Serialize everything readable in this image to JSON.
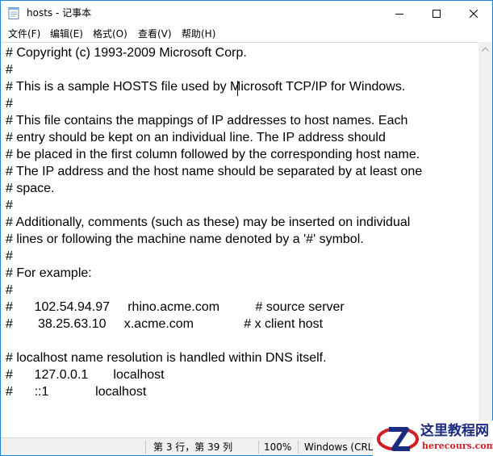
{
  "window": {
    "title": "hosts - 记事本"
  },
  "menu": [
    "文件(F)",
    "编辑(E)",
    "格式(O)",
    "查看(V)",
    "帮助(H)"
  ],
  "document": {
    "lines": [
      "# Copyright (c) 1993-2009 Microsoft Corp.",
      "#",
      "# This is a sample HOSTS file used by Microsoft TCP/IP for Windows.",
      "#",
      "# This file contains the mappings of IP addresses to host names. Each",
      "# entry should be kept on an individual line. The IP address should",
      "# be placed in the first column followed by the corresponding host name.",
      "# The IP address and the host name should be separated by at least one",
      "# space.",
      "#",
      "# Additionally, comments (such as these) may be inserted on individual",
      "# lines or following the machine name denoted by a '#' symbol.",
      "#",
      "# For example:",
      "#",
      "#      102.54.94.97     rhino.acme.com          # source server",
      "#       38.25.63.10     x.acme.com              # x client host",
      "",
      "# localhost name resolution is handled within DNS itself.",
      "#\t127.0.0.1       localhost",
      "#\t::1             localhost"
    ]
  },
  "status": {
    "position": "第 3 行，第 39 列",
    "zoom": "100%",
    "line_ending": "Windows (CRLF)"
  },
  "watermark": {
    "name": "这里教程网",
    "site": "herecours.com"
  },
  "colors": {
    "window_border": "#1883d7",
    "watermark_name": "#1a2c80",
    "watermark_site": "#d21f25"
  }
}
